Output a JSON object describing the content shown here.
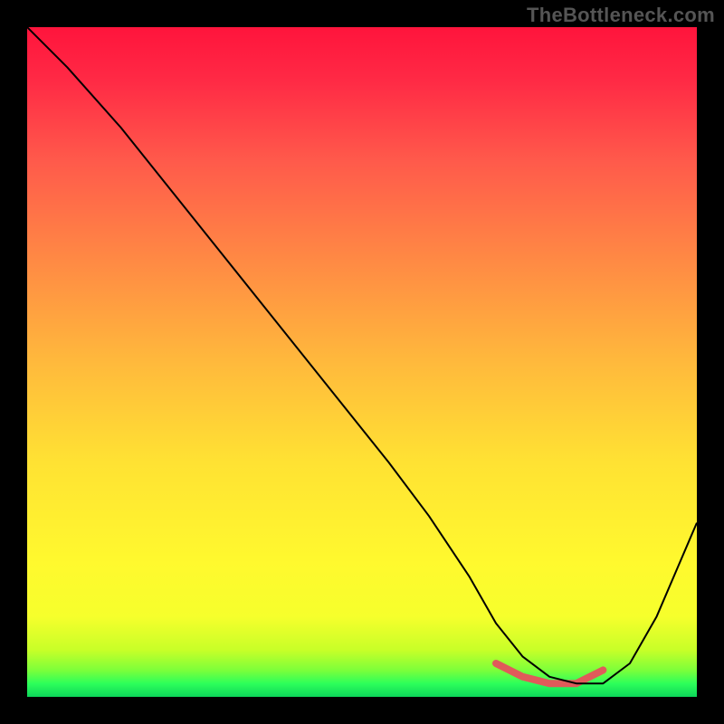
{
  "watermark": "TheBottleneck.com",
  "chart_data": {
    "type": "line",
    "title": "",
    "xlabel": "",
    "ylabel": "",
    "xlim": [
      0,
      100
    ],
    "ylim": [
      0,
      100
    ],
    "grid": false,
    "legend": false,
    "series": [
      {
        "name": "curve",
        "x": [
          0,
          6,
          14,
          22,
          30,
          38,
          46,
          54,
          60,
          66,
          70,
          74,
          78,
          82,
          86,
          90,
          94,
          100
        ],
        "y": [
          100,
          94,
          85,
          75,
          65,
          55,
          45,
          35,
          27,
          18,
          11,
          6,
          3,
          2,
          2,
          5,
          12,
          26
        ]
      }
    ],
    "highlight_segment": {
      "name": "minimum-band",
      "x": [
        70,
        74,
        78,
        82,
        86
      ],
      "y": [
        5,
        3,
        2,
        2,
        4
      ]
    },
    "background_gradient_stops": [
      {
        "pos": 0,
        "color": "#ff143c"
      },
      {
        "pos": 8,
        "color": "#ff2a45"
      },
      {
        "pos": 20,
        "color": "#ff5a4b"
      },
      {
        "pos": 35,
        "color": "#ff8a44"
      },
      {
        "pos": 50,
        "color": "#ffb93c"
      },
      {
        "pos": 65,
        "color": "#ffe233"
      },
      {
        "pos": 80,
        "color": "#fff92e"
      },
      {
        "pos": 88,
        "color": "#f6ff2c"
      },
      {
        "pos": 93,
        "color": "#c8ff28"
      },
      {
        "pos": 96,
        "color": "#7dff3a"
      },
      {
        "pos": 98,
        "color": "#2dff5a"
      },
      {
        "pos": 100,
        "color": "#0dd65a"
      }
    ]
  }
}
